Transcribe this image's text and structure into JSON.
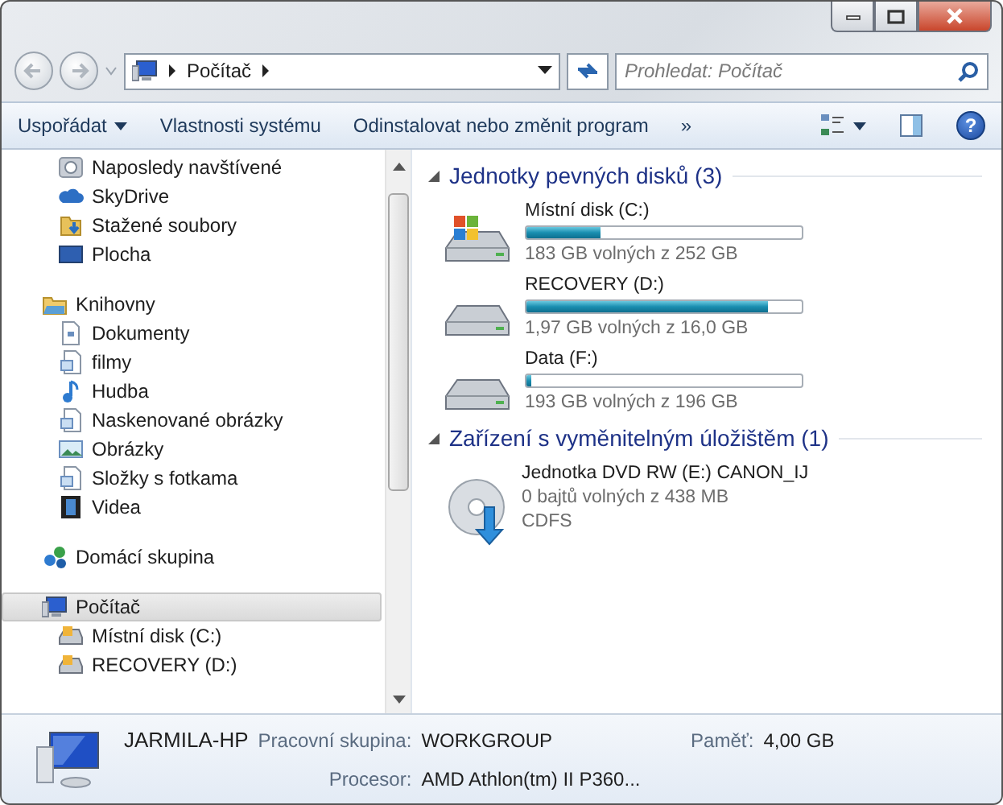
{
  "address_bar": {
    "crumbs": [
      "Počítač"
    ],
    "search_placeholder": "Prohledat: Počítač"
  },
  "toolbar": {
    "items": [
      {
        "label": "Uspořádat",
        "kind": "menu"
      },
      {
        "label": "Vlastnosti systému",
        "kind": "button"
      },
      {
        "label": "Odinstalovat nebo změnit program",
        "kind": "button"
      },
      {
        "label": "»",
        "kind": "button"
      }
    ],
    "help_label": "?"
  },
  "sidebar": [
    {
      "children": [
        {
          "label": "Naposledy navštívené",
          "selected": false
        },
        {
          "label": "SkyDrive",
          "selected": false
        },
        {
          "label": "Stažené soubory",
          "selected": false
        },
        {
          "label": "Plocha",
          "selected": false
        }
      ]
    },
    {
      "label": "Knihovny",
      "selected": false,
      "children": [
        {
          "label": "Dokumenty",
          "selected": false
        },
        {
          "label": "filmy",
          "selected": false
        },
        {
          "label": "Hudba",
          "selected": false
        },
        {
          "label": "Naskenované obrázky",
          "selected": false
        },
        {
          "label": "Obrázky",
          "selected": false
        },
        {
          "label": "Složky s fotkama",
          "selected": false
        },
        {
          "label": "Videa",
          "selected": false
        }
      ]
    },
    {
      "label": "Domácí skupina",
      "selected": false
    },
    {
      "label": "Počítač",
      "selected": true,
      "children": [
        {
          "label": "Místní disk (C:)",
          "selected": false
        },
        {
          "label": "RECOVERY (D:)",
          "selected": false
        }
      ]
    }
  ],
  "sections": [
    {
      "title": "Jednotky pevných disků (3)",
      "expanded": true,
      "drives": [
        {
          "kind": "system",
          "name": "Místní disk (C:)",
          "level": 0.27,
          "reading": "183 GB volných z 252 GB"
        },
        {
          "kind": "hdd",
          "name": "RECOVERY (D:)",
          "level": 0.88,
          "reading": "1,97 GB volných z 16,0 GB"
        },
        {
          "kind": "hdd",
          "name": "Data (F:)",
          "level": 0.015,
          "reading": "193 GB volných z 196 GB"
        }
      ]
    },
    {
      "title": "Zařízení s vyměnitelným úložištěm (1)",
      "expanded": true,
      "drives": [
        {
          "kind": "dvd",
          "name": "Jednotka DVD RW (E:) CANON_IJ",
          "reading": "0 bajtů volných z 438 MB",
          "filesystem": "CDFS"
        }
      ]
    }
  ],
  "details": {
    "computer_name": "JARMILA-HP",
    "fields": [
      {
        "label": "Pracovní skupina:",
        "value": "WORKGROUP"
      },
      {
        "label": "Paměť:",
        "value": "4,00 GB"
      },
      {
        "label": "Procesor:",
        "value": "AMD Athlon(tm) II P360..."
      }
    ]
  }
}
